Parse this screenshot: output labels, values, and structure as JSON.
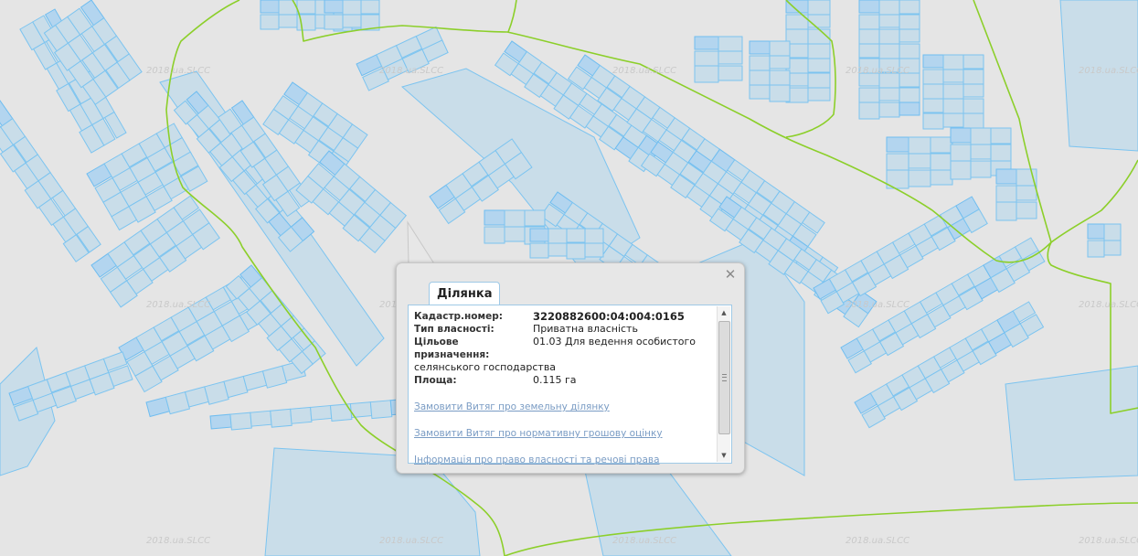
{
  "map": {
    "watermark": "2018.ua.SLCC",
    "colors": {
      "background": "#e5e5e5",
      "parcel_fill": "#c9dde9",
      "parcel_stroke": "#7cc4f0",
      "boundary": "#8ccf2a"
    }
  },
  "popup": {
    "tab_label": "Ділянка",
    "close_icon": "close-icon",
    "fields": {
      "cadastral_label": "Кадастр.номер:",
      "cadastral_value": "3220882600:04:004:0165",
      "ownership_label": "Тип власності:",
      "ownership_value": "Приватна власність",
      "purpose_label": "Цільове призначення:",
      "purpose_value_line1": "01.03 Для ведення особистого",
      "purpose_value_line2": "селянського господарства",
      "area_label": "Площа:",
      "area_value": "0.115 га"
    },
    "links": {
      "extract_land": "Замовити Витяг про земельну ділянку",
      "extract_valuation": "Замовити Витяг про нормативну грошову оцінку",
      "rights_info": "Інформація про право власності та речові права"
    }
  }
}
